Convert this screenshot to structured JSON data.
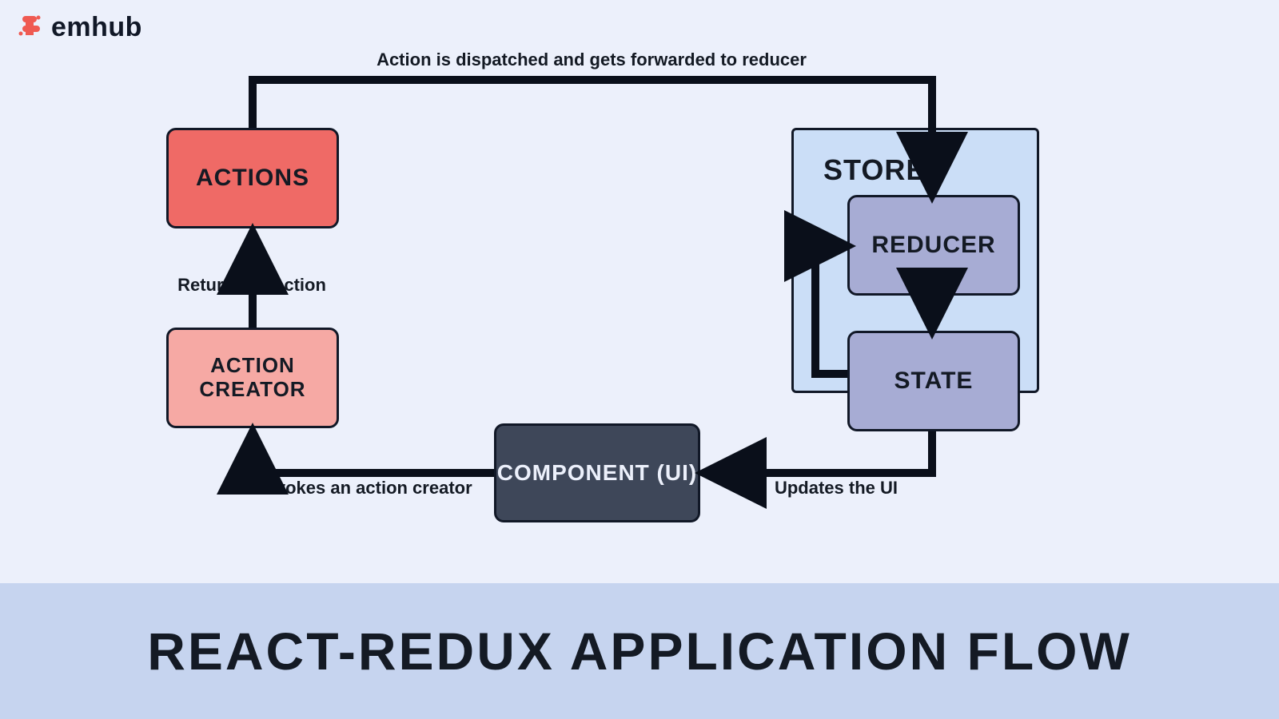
{
  "logo": {
    "prefix": "em",
    "suffix": "hub"
  },
  "nodes": {
    "actions": "Actions",
    "action_creator": "Action Creator",
    "component": "Component (UI)",
    "store": "Store",
    "reducer": "Reducer",
    "state": "State"
  },
  "edges": {
    "dispatch": "Action is dispatched and gets forwarded to reducer",
    "returns": "Returns an action",
    "invokes": "Invokes an action creator",
    "updates": "Updates the UI"
  },
  "title": "React-Redux  Application  Flow",
  "flow": [
    {
      "from": "component",
      "to": "action_creator",
      "label_key": "invokes"
    },
    {
      "from": "action_creator",
      "to": "actions",
      "label_key": "returns"
    },
    {
      "from": "actions",
      "to": "reducer",
      "label_key": "dispatch"
    },
    {
      "from": "reducer",
      "to": "state",
      "label_key": null
    },
    {
      "from": "state",
      "to": "reducer",
      "label_key": null
    },
    {
      "from": "state",
      "to": "component",
      "label_key": "updates"
    }
  ]
}
